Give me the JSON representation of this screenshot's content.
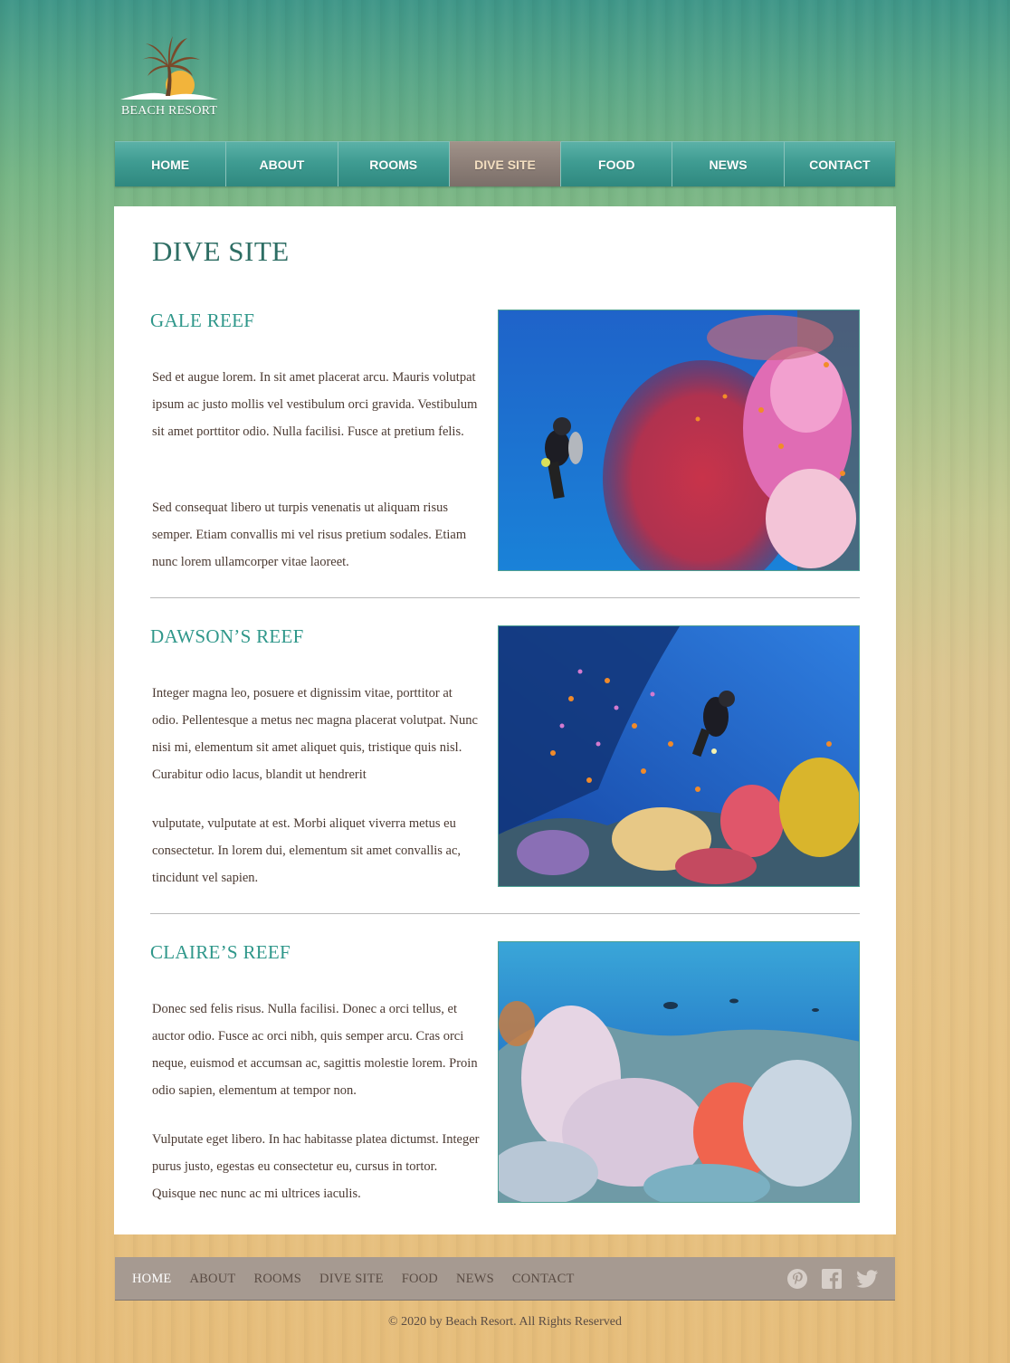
{
  "brand": {
    "name": "BEACH RESORT"
  },
  "nav": {
    "items": [
      {
        "label": "HOME"
      },
      {
        "label": "ABOUT"
      },
      {
        "label": "ROOMS"
      },
      {
        "label": "DIVE SITE",
        "active": true
      },
      {
        "label": "FOOD"
      },
      {
        "label": "NEWS"
      },
      {
        "label": "CONTACT"
      }
    ]
  },
  "page": {
    "title": "DIVE SITE"
  },
  "sections": [
    {
      "title": "GALE REEF",
      "paragraphs": [
        "Sed et augue lorem. In sit amet placerat arcu. Mauris volutpat ipsum ac justo mollis vel vestibulum orci gravida. Vestibulum sit amet porttitor odio. Nulla facilisi. Fusce at pretium felis.",
        "Sed consequat libero ut turpis venenatis ut aliquam risus semper. Etiam convallis mi vel risus pretium sodales. Etiam nunc lorem ullamcorper vitae laoreet."
      ]
    },
    {
      "title": "DAWSON’S REEF",
      "paragraphs": [
        "Integer magna leo, posuere et dignissim vitae, porttitor at odio. Pellentesque a metus nec magna placerat volutpat. Nunc nisi mi, elementum sit amet aliquet quis, tristique quis nisl. Curabitur odio lacus, blandit ut hendrerit",
        "vulputate, vulputate at est. Morbi aliquet viverra metus eu consectetur. In lorem dui, elementum sit amet convallis ac, tincidunt vel sapien."
      ]
    },
    {
      "title": "CLAIRE’S REEF",
      "paragraphs": [
        "Donec sed felis risus. Nulla facilisi. Donec a orci tellus, et auctor odio. Fusce ac orci nibh, quis semper arcu. Cras orci neque, euismod et accumsan ac, sagittis molestie lorem. Proin odio sapien, elementum at tempor non.",
        "Vulputate eget libero. In hac habitasse platea dictumst. Integer purus justo, egestas eu consectetur eu, cursus in tortor. Quisque nec nunc ac mi ultrices iaculis."
      ]
    }
  ],
  "footer": {
    "links": [
      {
        "label": "HOME",
        "active": true
      },
      {
        "label": "ABOUT"
      },
      {
        "label": "ROOMS"
      },
      {
        "label": "DIVE SITE"
      },
      {
        "label": "FOOD"
      },
      {
        "label": "NEWS"
      },
      {
        "label": "CONTACT"
      }
    ],
    "social_icons": [
      "pinterest-icon",
      "facebook-icon",
      "twitter-icon"
    ],
    "copyright": "© 2020 by Beach Resort. All Rights Reserved"
  },
  "colors": {
    "accent_teal": "#2f978a",
    "nav_teal": "#3f9c92",
    "nav_active": "#8d7f78",
    "footer_bar": "#a69a91"
  }
}
